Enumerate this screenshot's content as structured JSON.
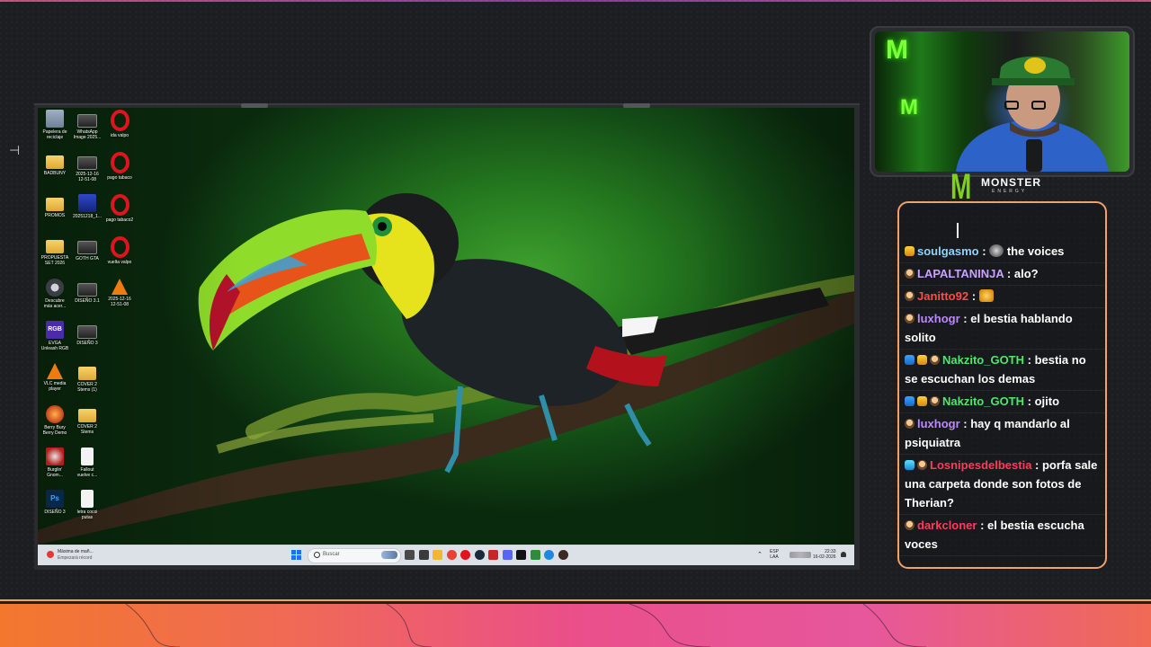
{
  "desktop": {
    "icons": [
      {
        "label": "Papelera de\nreciclaje",
        "icon": "recycle-bin-icon",
        "kind": "bin"
      },
      {
        "label": "WhatsApp\nImage 2025...",
        "icon": "image-file-icon",
        "kind": "thumb"
      },
      {
        "label": "ida valpo",
        "icon": "opera-icon",
        "kind": "opera"
      },
      {
        "label": "BADBUNY",
        "icon": "folder-icon",
        "kind": "folder"
      },
      {
        "label": "2025-12-16\n12-51-08",
        "icon": "video-file-icon",
        "kind": "thumb"
      },
      {
        "label": "pago tabaco",
        "icon": "opera-icon",
        "kind": "opera"
      },
      {
        "label": "PROMOS",
        "icon": "folder-icon",
        "kind": "folder"
      },
      {
        "label": "20251218_1...",
        "icon": "image-file-icon",
        "kind": "blue"
      },
      {
        "label": "pago tabaco2",
        "icon": "opera-icon",
        "kind": "opera"
      },
      {
        "label": "PROPUESTA\nSET 2026",
        "icon": "folder-icon",
        "kind": "folder"
      },
      {
        "label": "GOTH GTA",
        "icon": "video-file-icon",
        "kind": "thumb"
      },
      {
        "label": "vuelta valpo",
        "icon": "opera-icon",
        "kind": "opera"
      },
      {
        "label": "Descubre\nmás acer...",
        "icon": "clock-app-icon",
        "kind": "steam"
      },
      {
        "label": "DISEÑO 3.1",
        "icon": "image-file-icon",
        "kind": "thumb"
      },
      {
        "label": "2025-12-16\n12-51-08",
        "icon": "vlc-icon",
        "kind": "vlc"
      },
      {
        "label": "EVGA\nUnleash RGB",
        "icon": "rgb-app-icon",
        "kind": "rgb"
      },
      {
        "label": "DISEÑO 3",
        "icon": "image-file-icon",
        "kind": "thumb"
      },
      {
        "label": "",
        "icon": "",
        "kind": "none"
      },
      {
        "label": "VLC media\nplayer",
        "icon": "vlc-icon",
        "kind": "vlc"
      },
      {
        "label": "COVER 2\nStems (1)",
        "icon": "folder-icon",
        "kind": "folder"
      },
      {
        "label": "",
        "icon": "",
        "kind": "none"
      },
      {
        "label": "Berry Bury\nBerry Demo",
        "icon": "game-icon",
        "kind": "berry"
      },
      {
        "label": "COVER 2\nStems",
        "icon": "folder-icon",
        "kind": "folder"
      },
      {
        "label": "",
        "icon": "",
        "kind": "none"
      },
      {
        "label": "Burglin'\nGnom...",
        "icon": "game-icon",
        "kind": "burg"
      },
      {
        "label": "Fallout\nvuelve c...",
        "icon": "document-icon",
        "kind": "doc"
      },
      {
        "label": "",
        "icon": "",
        "kind": "none"
      },
      {
        "label": "DISEÑO 3",
        "icon": "photoshop-icon",
        "kind": "ps"
      },
      {
        "label": "letra cocoi\nputas",
        "icon": "document-icon",
        "kind": "doc"
      }
    ]
  },
  "taskbar": {
    "weather_line1": "Máxima de mañ...",
    "weather_line2": "Empezará récord",
    "search_placeholder": "Buscar",
    "apps": [
      "file-explorer-icon",
      "task-view-icon",
      "folder-icon",
      "chrome-icon",
      "opera-icon",
      "steam-icon",
      "mail-icon",
      "discord-icon",
      "capcut-icon",
      "xbox-icon",
      "edge-icon",
      "obs-icon"
    ],
    "app_colors": [
      "#4a4a4a",
      "#3a3a3a",
      "#f2b632",
      "#e94235",
      "#e0141e",
      "#1b2838",
      "#c62828",
      "#5865f2",
      "#111111",
      "#2e8b3a",
      "#1e88e5",
      "#3b2a24"
    ],
    "lang_line1": "ESP",
    "lang_line2": "LAA",
    "time": "22:33",
    "date": "16-02-2026"
  },
  "webcam": {
    "overlay_label": "M"
  },
  "sponsor": {
    "claw": "M",
    "name": "MONSTER",
    "sub": "ENERGY"
  },
  "chat": {
    "messages": [
      {
        "user": "soulgasmo",
        "color": "#8fd3ff",
        "text": " the voices",
        "badges": [
          "gold"
        ],
        "emote": "face"
      },
      {
        "user": "LAPALTANINJA",
        "color": "#c8a2ff",
        "text": " alo?",
        "badges": [
          "mask"
        ]
      },
      {
        "user": "Janitto92",
        "color": "#ff4a4a",
        "text": " ",
        "badges": [
          "mask"
        ],
        "emote": "cat"
      },
      {
        "user": "luxhogr",
        "color": "#b98bff",
        "text": " el bestia hablando solito",
        "badges": [
          "mask"
        ]
      },
      {
        "user": "Nakzito_GOTH",
        "color": "#4de86b",
        "text": " bestia no se escuchan los demas",
        "badges": [
          "blue",
          "gold",
          "mask"
        ]
      },
      {
        "user": "Nakzito_GOTH",
        "color": "#4de86b",
        "text": " ojito",
        "badges": [
          "blue",
          "gold",
          "mask"
        ]
      },
      {
        "user": "luxhogr",
        "color": "#b98bff",
        "text": " hay q mandarlo al psiquiatra",
        "badges": [
          "mask"
        ]
      },
      {
        "user": "Losnipesdelbestia",
        "color": "#ff3a5c",
        "text": " porfa sale una carpeta donde son fotos de Therian?",
        "badges": [
          "cyan",
          "mask"
        ]
      },
      {
        "user": "darkcloner",
        "color": "#ff3a5c",
        "text": " el bestia escucha voces",
        "badges": [
          "mask"
        ]
      }
    ]
  }
}
